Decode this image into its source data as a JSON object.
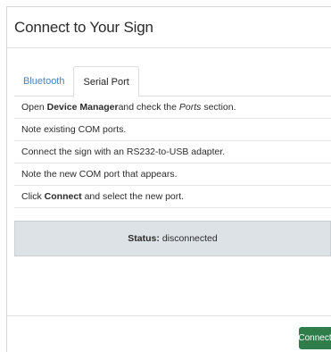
{
  "dialog": {
    "title": "Connect to Your Sign"
  },
  "tabs": [
    {
      "label": "Bluetooth",
      "active": false
    },
    {
      "label": "Serial Port",
      "active": true
    }
  ],
  "steps": [
    {
      "pre": "Open ",
      "bold": "Device Manager",
      "mid": " and check the ",
      "italic": "Ports",
      "post": " section."
    },
    {
      "text": "Note existing COM ports."
    },
    {
      "text": "Connect the sign with an RS232-to-USB adapter."
    },
    {
      "text": "Note the new COM port that appears."
    },
    {
      "bold": "Connect",
      "pre": "Click ",
      "post": " and select the new port."
    }
  ],
  "status": {
    "label": "Status:",
    "value": "disconnected",
    "background_color": "#dde2e6"
  },
  "footer": {
    "connect_label": "Connect",
    "connect_color": "#2e7d4a"
  }
}
